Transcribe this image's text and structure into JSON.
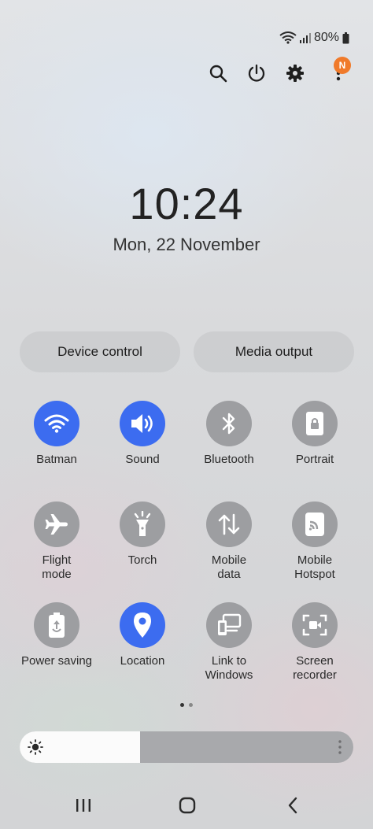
{
  "status_bar": {
    "battery": "80%"
  },
  "top_actions": {
    "notification_badge": "N"
  },
  "clock": {
    "time": "10:24",
    "date": "Mon, 22 November"
  },
  "quick_buttons": {
    "device_control": "Device control",
    "media_output": "Media output"
  },
  "tiles": [
    {
      "label": "Batman",
      "icon": "wifi-icon",
      "active": true
    },
    {
      "label": "Sound",
      "icon": "speaker-icon",
      "active": true
    },
    {
      "label": "Bluetooth",
      "icon": "bluetooth-icon",
      "active": false
    },
    {
      "label": "Portrait",
      "icon": "portrait-lock-icon",
      "active": false
    },
    {
      "label": "Flight\nmode",
      "icon": "airplane-icon",
      "active": false
    },
    {
      "label": "Torch",
      "icon": "flashlight-icon",
      "active": false
    },
    {
      "label": "Mobile\ndata",
      "icon": "data-arrows-icon",
      "active": false
    },
    {
      "label": "Mobile\nHotspot",
      "icon": "hotspot-icon",
      "active": false
    },
    {
      "label": "Power saving",
      "icon": "battery-saver-icon",
      "active": false
    },
    {
      "label": "Location",
      "icon": "location-pin-icon",
      "active": true
    },
    {
      "label": "Link to\nWindows",
      "icon": "link-windows-icon",
      "active": false
    },
    {
      "label": "Screen\nrecorder",
      "icon": "screen-recorder-icon",
      "active": false
    }
  ],
  "page_indicator": {
    "pages": 2,
    "current": 1
  },
  "brightness": {
    "level": 0.36
  },
  "colors": {
    "active_tile": "#3c6cf0",
    "inactive_tile": "#9d9ea1",
    "badge": "#f07a2a"
  }
}
